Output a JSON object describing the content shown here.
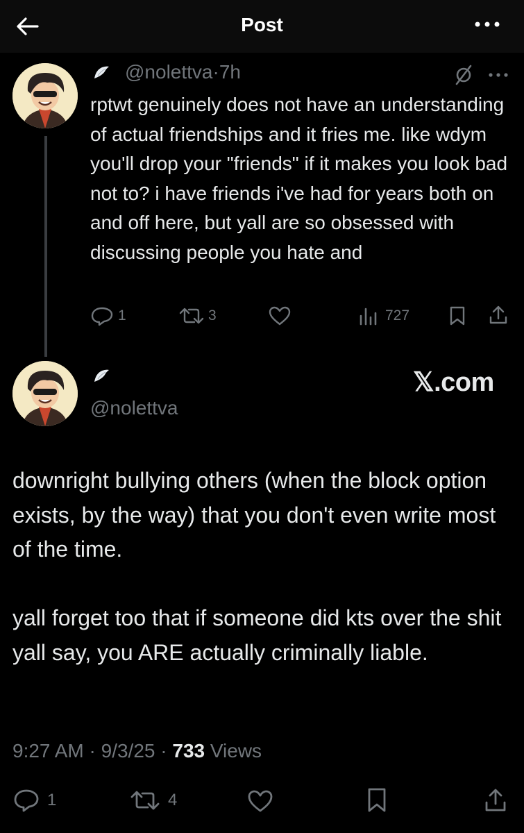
{
  "header": {
    "title": "Post"
  },
  "reply_tweet": {
    "handle": "@nolettva",
    "separator": "·",
    "time": "7h",
    "text": "rptwt genuinely does not have an understanding of actual friendships and it fries me. like wdym you'll drop your \"friends\" if it makes you look bad not to? i have friends i've had for years both on and off here, but yall are so obsessed with discussing people you hate and",
    "replies": "1",
    "reposts": "3",
    "views": "727"
  },
  "main_tweet": {
    "handle": "@nolettva",
    "source": "𝕏.com",
    "paragraph1": "downright bullying others (when the block option exists, by the way) that you don't even write most of the time.",
    "paragraph2": "yall forget too that if someone did kts over the shit yall say, you ARE actually criminally liable.",
    "time": "9:27 AM",
    "date": "9/3/25",
    "views_count": "733",
    "views_label": "Views",
    "dot": "·",
    "replies": "1",
    "reposts": "4"
  },
  "colors": {
    "background": "#000000",
    "text": "#e7e9ea",
    "muted": "#71767b"
  }
}
